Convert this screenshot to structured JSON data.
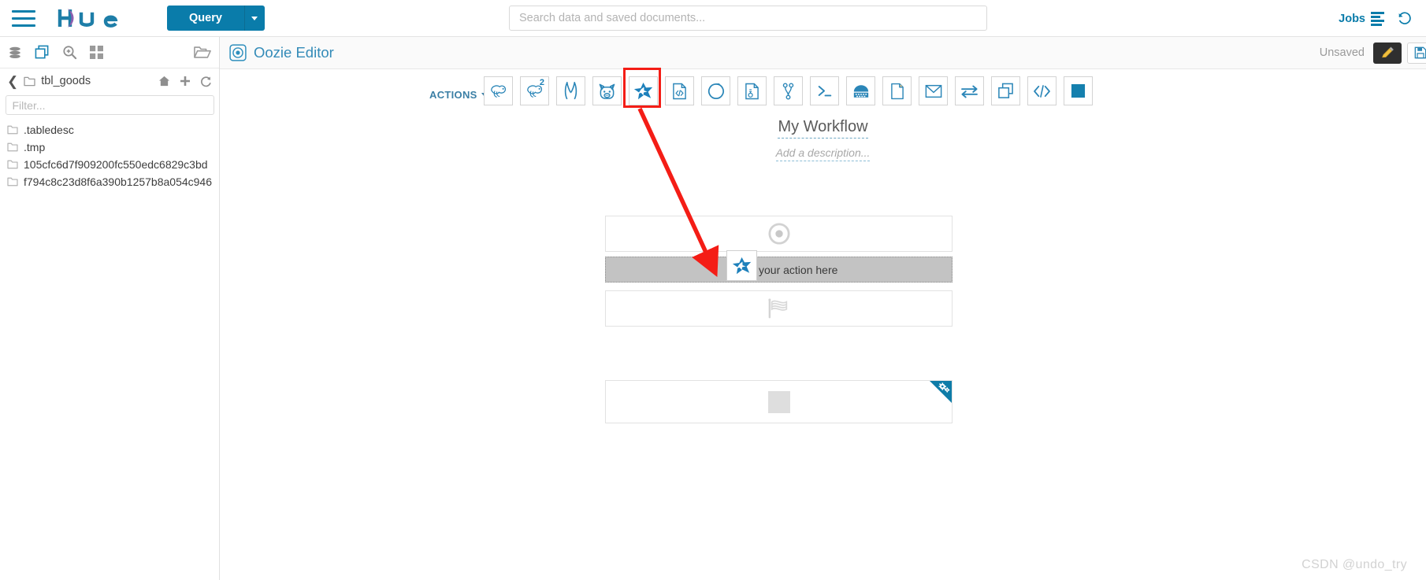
{
  "topnav": {
    "hamburger_icon": "hamburger-menu-icon",
    "brand": "hue",
    "query_label": "Query",
    "search_placeholder": "Search data and saved documents...",
    "search_value": "",
    "jobs_label": "Jobs",
    "jobs_icon": "jobs-list-icon",
    "history_icon": "history-clock-icon"
  },
  "sidebar": {
    "assist_icons": [
      {
        "name": "database-icon",
        "title": "Sources"
      },
      {
        "name": "documents-icon",
        "title": "Documents"
      },
      {
        "name": "search-zoom-icon",
        "title": "Search"
      },
      {
        "name": "apps-grid-icon",
        "title": "Apps"
      },
      {
        "name": "open-folder-icon",
        "title": "Browse"
      }
    ],
    "breadcrumb": {
      "back_icon": "chevron-left-icon",
      "folder_icon": "folder-icon",
      "path": "tbl_goods",
      "home_icon": "home-icon",
      "add_icon": "plus-icon",
      "refresh_icon": "refresh-icon"
    },
    "filter_placeholder": "Filter...",
    "filter_value": "",
    "files": [
      ".tabledesc",
      ".tmp",
      "105cfc6d7f909200fc550edc6829c3bd",
      "f794c8c23d8f6a390b1257b8a054c946"
    ]
  },
  "page": {
    "icon": "oozie-editor-icon",
    "title": "Oozie Editor",
    "status": "Unsaved",
    "edit_icon": "pencil-edit-icon",
    "save_icon": "save-floppy-icon"
  },
  "toolbar": {
    "actions_label": "ACTIONS",
    "items": [
      {
        "name": "hive-action-icon",
        "label": "Hive",
        "badge": ""
      },
      {
        "name": "hive-server2-action-icon",
        "label": "HiveServer2",
        "badge": "2"
      },
      {
        "name": "impala-action-icon",
        "label": "Impala",
        "badge": ""
      },
      {
        "name": "pig-action-icon",
        "label": "Pig",
        "badge": ""
      },
      {
        "name": "spark-action-icon",
        "label": "Spark",
        "badge": "",
        "highlighted": true
      },
      {
        "name": "java-action-icon",
        "label": "Java",
        "badge": ""
      },
      {
        "name": "sqoop-action-icon",
        "label": "Sqoop",
        "badge": ""
      },
      {
        "name": "mapreduce-action-icon",
        "label": "MapReduce",
        "badge": ""
      },
      {
        "name": "subworkflow-action-icon",
        "label": "Sub-workflow",
        "badge": ""
      },
      {
        "name": "shell-action-icon",
        "label": "Shell",
        "badge": ""
      },
      {
        "name": "sqoop1-action-icon",
        "label": "Sqoop 1",
        "badge": ""
      },
      {
        "name": "fs-action-icon",
        "label": "Fs",
        "badge": ""
      },
      {
        "name": "email-action-icon",
        "label": "Email",
        "badge": ""
      },
      {
        "name": "distcp-action-icon",
        "label": "DistCp",
        "badge": ""
      },
      {
        "name": "streaming-action-icon",
        "label": "Streaming",
        "badge": ""
      },
      {
        "name": "generic-action-icon",
        "label": "Generic",
        "badge": ""
      },
      {
        "name": "kill-action-icon",
        "label": "Kill",
        "badge": ""
      }
    ]
  },
  "workflow": {
    "title": "My Workflow",
    "description_placeholder": "Add a description...",
    "start_node_icon": "start-target-icon",
    "dropzone_label": "your action here",
    "dragged_icon": "spark-action-icon",
    "end_node_icon": "end-checkered-flag-icon",
    "kill_node_icon": "kill-square-icon",
    "kill_settings_icon": "gears-settings-icon"
  },
  "annotation": {
    "box_color": "#f41d16",
    "arrow_color": "#f41d16"
  },
  "watermark": "CSDN @undo_try"
}
